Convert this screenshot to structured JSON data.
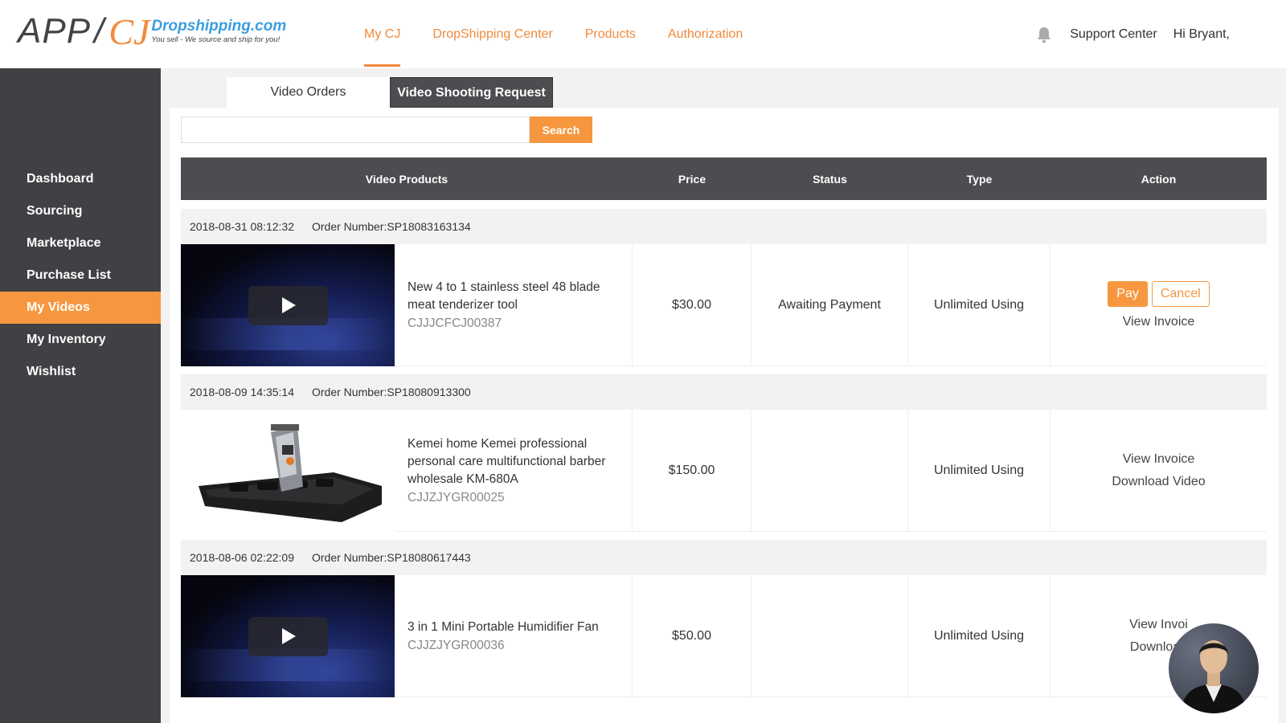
{
  "logo": {
    "app": "APP",
    "slash": "/",
    "cj": "CJ",
    "domain": "Dropshipping.com",
    "tagline": "You sell - We source and ship for you!"
  },
  "topnav": [
    {
      "label": "My CJ",
      "active": true
    },
    {
      "label": "DropShipping Center",
      "active": false
    },
    {
      "label": "Products",
      "active": false
    },
    {
      "label": "Authorization",
      "active": false
    }
  ],
  "header": {
    "support": "Support Center",
    "greeting": "Hi Bryant,"
  },
  "sidebar": {
    "items": [
      {
        "label": "Dashboard"
      },
      {
        "label": "Sourcing"
      },
      {
        "label": "Marketplace"
      },
      {
        "label": "Purchase List"
      },
      {
        "label": "My Videos"
      },
      {
        "label": "My Inventory"
      },
      {
        "label": "Wishlist"
      }
    ],
    "active_index": 4
  },
  "tabs": [
    {
      "label": "Video Orders"
    },
    {
      "label": "Video Shooting Request"
    }
  ],
  "search": {
    "placeholder": "",
    "button": "Search"
  },
  "table": {
    "headers": [
      "Video Products",
      "Price",
      "Status",
      "Type",
      "Action"
    ]
  },
  "orders": [
    {
      "date": "2018-08-31 08:12:32",
      "order_label": "Order Number:",
      "order_number": "SP18083163134",
      "title": "New 4 to 1 stainless steel 48 blade meat tenderizer tool",
      "sku": "CJJJCFCJ00387",
      "price": "$30.00",
      "status": "Awaiting Payment",
      "type": "Unlimited Using",
      "pay": "Pay",
      "cancel": "Cancel",
      "link1": "View Invoice"
    },
    {
      "date": "2018-08-09 14:35:14",
      "order_label": "Order Number:",
      "order_number": "SP18080913300",
      "title": "Kemei home Kemei professional personal care multifunctional barber wholesale KM-680A",
      "sku": "CJJZJYGR00025",
      "price": "$150.00",
      "status": "",
      "type": "Unlimited Using",
      "link1": "View Invoice",
      "link2": "Download Video"
    },
    {
      "date": "2018-08-06 02:22:09",
      "order_label": "Order Number:",
      "order_number": "SP18080617443",
      "title": "3 in 1 Mini Portable Humidifier Fan",
      "sku": "CJJZJYGR00036",
      "price": "$50.00",
      "status": "",
      "type": "Unlimited Using",
      "link1": "View Invoi",
      "link2": "Download"
    }
  ],
  "colors": {
    "accent": "#f6973f",
    "nav_text": "#f08a3c",
    "sidebar_bg": "#3f4144",
    "table_header": "#4b4d50"
  }
}
